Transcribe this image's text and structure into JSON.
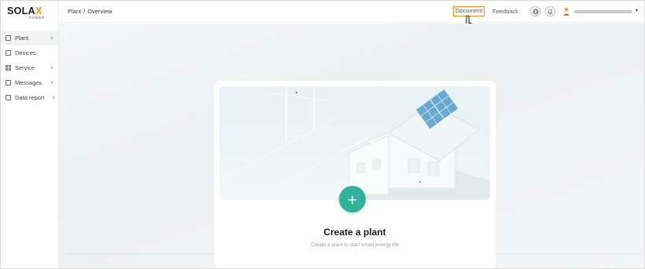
{
  "brand": {
    "name_main": "SOLA",
    "name_x": "X",
    "name_sub": "POWER",
    "accent": "#f39800"
  },
  "sidebar": {
    "items": [
      {
        "label": "Plant",
        "icon": "plant-icon",
        "has_chevron": true,
        "active": true
      },
      {
        "label": "Devices",
        "icon": "devices-icon",
        "has_chevron": false
      },
      {
        "label": "Service",
        "icon": "service-icon",
        "has_chevron": true
      },
      {
        "label": "Messages",
        "icon": "messages-icon",
        "has_chevron": true
      },
      {
        "label": "Data report",
        "icon": "data-report-icon",
        "has_chevron": true
      }
    ],
    "chevron": "∨"
  },
  "header": {
    "breadcrumb": {
      "root": "Plant",
      "separator": "/",
      "current": "Overview"
    },
    "document_label": "Document",
    "feedback_label": "Feedback",
    "globe_icon": "globe-icon",
    "bell_icon": "bell-icon",
    "caret": "▾",
    "highlight_color": "#f08a24"
  },
  "main": {
    "card": {
      "add_symbol": "+",
      "title": "Create a plant",
      "subtitle": "Create a plant to start smart energy life",
      "add_color": "#2fb39a"
    }
  }
}
